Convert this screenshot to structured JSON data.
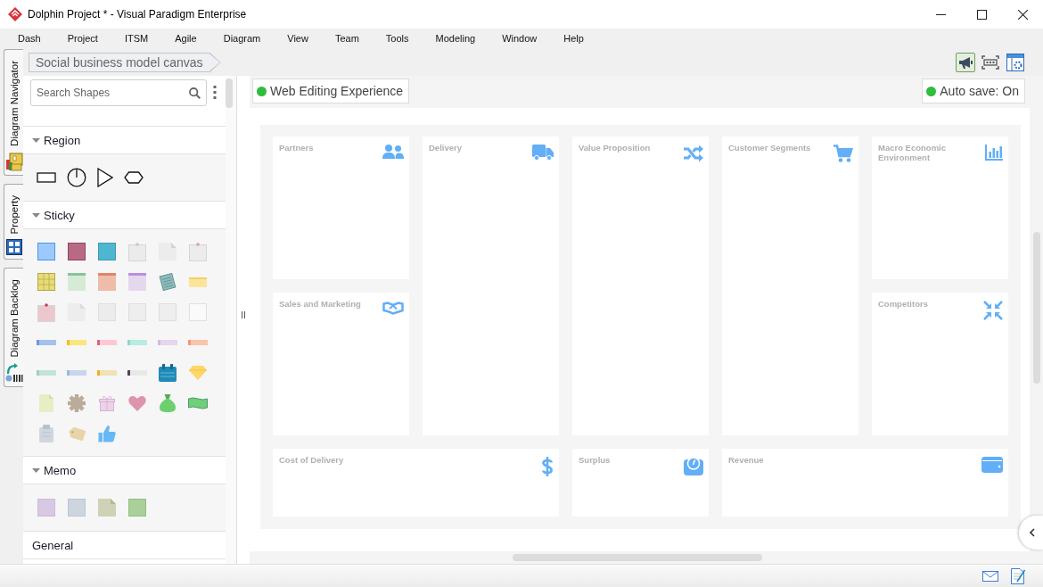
{
  "window": {
    "title": "Dolphin Project * - Visual Paradigm Enterprise"
  },
  "menu": [
    "Dash",
    "Project",
    "ITSM",
    "Agile",
    "Diagram",
    "View",
    "Team",
    "Tools",
    "Modeling",
    "Window",
    "Help"
  ],
  "side_tabs": [
    {
      "label": "Diagram Navigator",
      "selected": false
    },
    {
      "label": "Property",
      "selected": false
    },
    {
      "label": "Diagram Backlog",
      "selected": false
    }
  ],
  "breadcrumb": {
    "label": "Social business model canvas"
  },
  "toolbar": [
    {
      "pressed": true
    },
    {
      "pressed": false
    },
    {
      "pressed": false
    }
  ],
  "palette": {
    "search": {
      "placeholder": "Search Shapes"
    },
    "sections": [
      {
        "title": "Region",
        "expanded": true
      },
      {
        "title": "Sticky",
        "expanded": true
      },
      {
        "title": "Memo",
        "expanded": true
      },
      {
        "title": "General"
      }
    ]
  },
  "canvas": {
    "web_editing": {
      "label": "Web Editing Experience"
    },
    "auto_save": {
      "label": "Auto save: On"
    },
    "blocks": [
      {
        "title": "Partners"
      },
      {
        "title": "Delivery"
      },
      {
        "title": "Value Proposition"
      },
      {
        "title": "Customer Segments"
      },
      {
        "title": "Macro Economic Environment"
      },
      {
        "title": "Sales and Marketing"
      },
      {
        "title": "Competitors"
      },
      {
        "title": "Cost of Delivery"
      },
      {
        "title": "Surplus"
      },
      {
        "title": "Revenue"
      }
    ]
  }
}
